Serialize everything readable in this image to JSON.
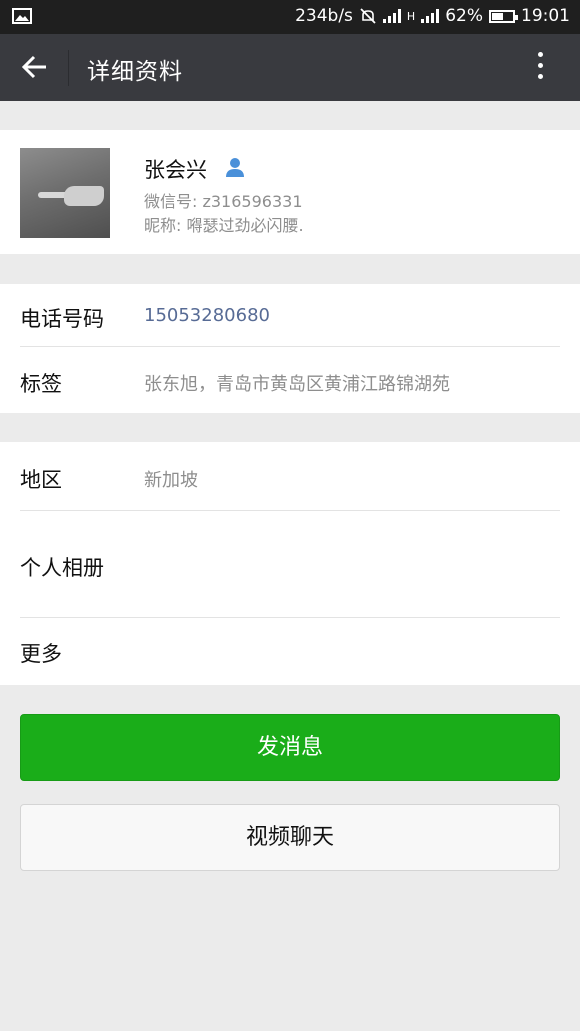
{
  "status_bar": {
    "speed": "234b/s",
    "network_label": "H",
    "battery": "62%",
    "time": "19:01",
    "battery_level": 0.62,
    "icons": [
      "image-icon",
      "mute-icon",
      "signal-icon",
      "battery-icon"
    ]
  },
  "header": {
    "title": "详细资料"
  },
  "profile": {
    "name": "张会兴",
    "wechat_id": "微信号: z316596331",
    "nickname": "昵称: 嘚瑟过劲必闪腰."
  },
  "info": {
    "phone_label": "电话号码",
    "phone_value": "15053280680",
    "tag_label": "标签",
    "tag_value": "张东旭，青岛市黄岛区黄浦江路锦湖苑"
  },
  "more_info": {
    "region_label": "地区",
    "region_value": "新加坡",
    "album_label": "个人相册",
    "more_label": "更多"
  },
  "actions": {
    "send_message": "发消息",
    "video_chat": "视频聊天"
  },
  "colors": {
    "header_bg": "#393a3f",
    "accent_green": "#1aad19",
    "link_blue": "#576b95",
    "secondary_text": "#8e8e8e"
  }
}
